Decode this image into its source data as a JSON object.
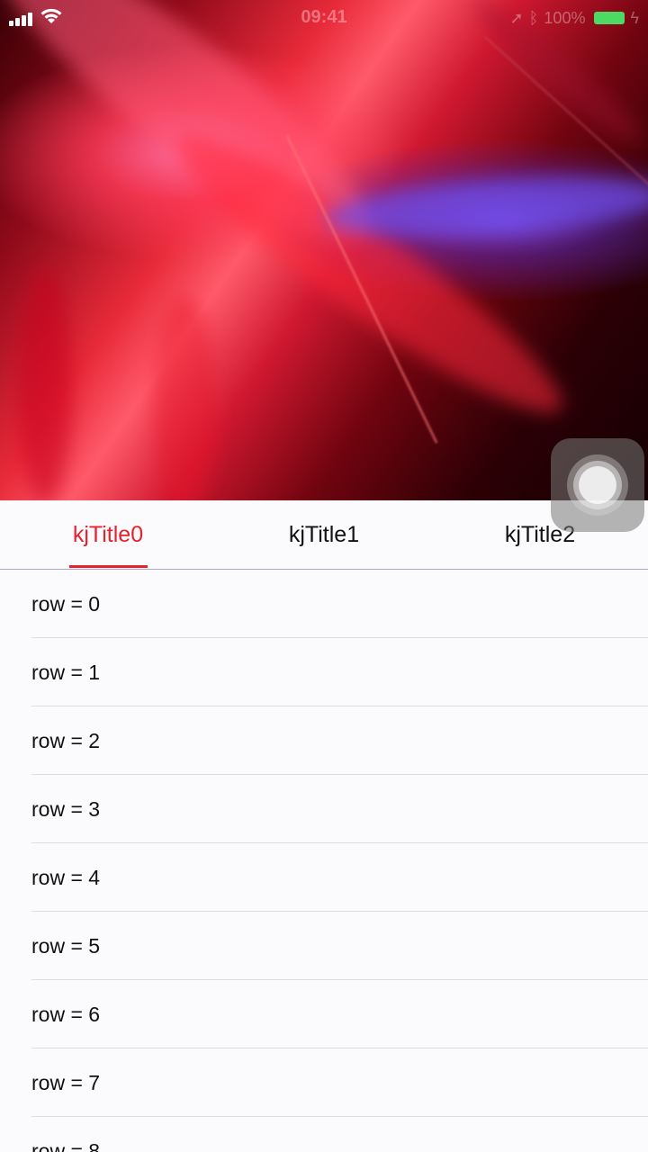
{
  "status_bar": {
    "time": "09:41",
    "battery_text": "100%",
    "battery_color": "#4cd964"
  },
  "hero": {
    "image": "abstract-red-light-streaks"
  },
  "tabs": [
    {
      "label": "kjTitle0",
      "active": true
    },
    {
      "label": "kjTitle1",
      "active": false
    },
    {
      "label": "kjTitle2",
      "active": false
    }
  ],
  "accent_color": "#e8212e",
  "rows": [
    {
      "label": "row = 0"
    },
    {
      "label": "row = 1"
    },
    {
      "label": "row = 2"
    },
    {
      "label": "row = 3"
    },
    {
      "label": "row = 4"
    },
    {
      "label": "row = 5"
    },
    {
      "label": "row = 6"
    },
    {
      "label": "row = 7"
    },
    {
      "label": "row = 8"
    }
  ],
  "assistive_touch": {
    "icon": "assistive-touch-icon"
  }
}
